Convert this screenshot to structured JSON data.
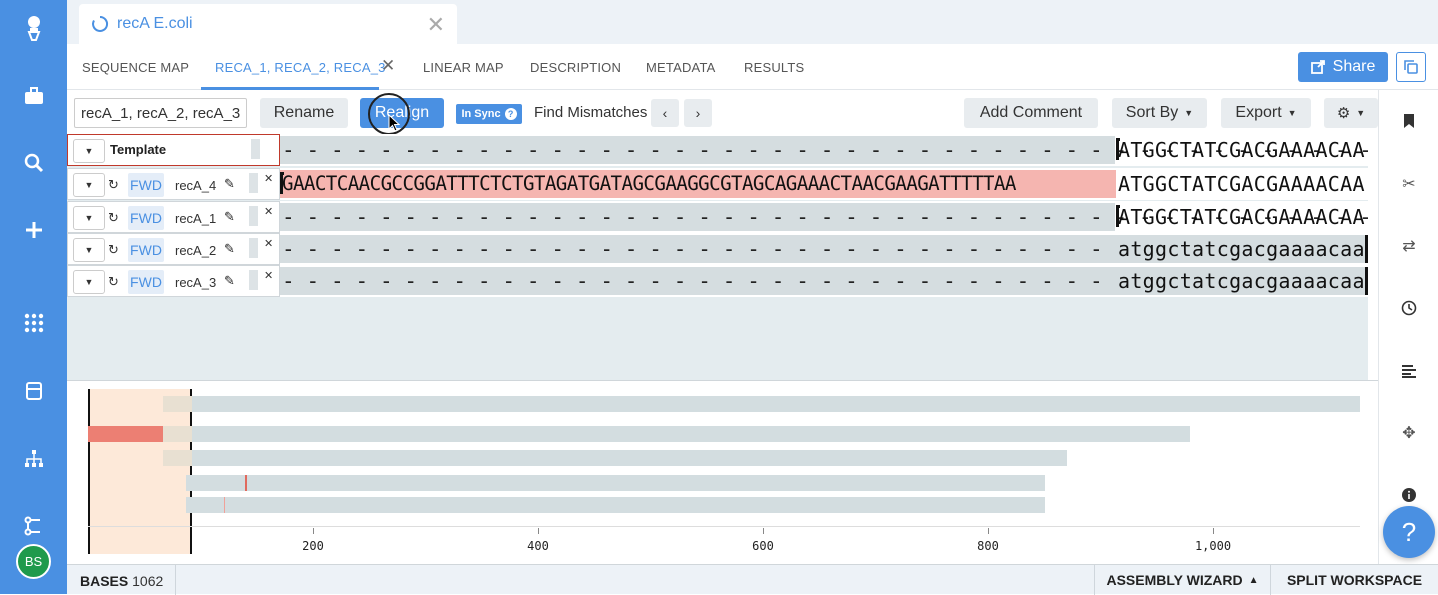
{
  "colors": {
    "accent": "#4a90e2",
    "mismatch": "#f5b5b0",
    "avatar": "#1f9a4c"
  },
  "leftnav": {
    "icons": [
      "logo-icon",
      "briefcase-icon",
      "search-icon",
      "plus-icon",
      "apps-grid-icon",
      "database-icon",
      "hierarchy-icon",
      "workflow-icon"
    ],
    "avatar": "BS"
  },
  "file_tab": {
    "title": "recA E.coli"
  },
  "tabs": [
    {
      "label": "SEQUENCE MAP"
    },
    {
      "label": "RECA_1, RECA_2, RECA_3"
    },
    {
      "label": "LINEAR MAP"
    },
    {
      "label": "DESCRIPTION"
    },
    {
      "label": "METADATA"
    },
    {
      "label": "RESULTS"
    }
  ],
  "share_label": "Share",
  "toolbar": {
    "name_value": "recA_1, recA_2, recA_3",
    "rename": "Rename",
    "realign": "Realign",
    "insync": "In Sync",
    "find_mismatches": "Find Mismatches",
    "add_comment": "Add Comment",
    "sort_by": "Sort By",
    "export": "Export"
  },
  "alignment": {
    "template_label": "Template",
    "template_bases": "ATGGCTATCGACGAAAACAA",
    "rows": [
      {
        "dir": "FWD",
        "name": "recA_4",
        "mismatch_bases": "GAACTCAACGCCGGATTTCTCTGTAGATGATAGCGAAGGCGTAGCAGAAACTAACGAAGATTTTTAA",
        "bases": "ATGGCTATCGACGAAAACAA"
      },
      {
        "dir": "FWD",
        "name": "recA_1",
        "bases": "ATGGCTATCGACGAAAACAA"
      },
      {
        "dir": "FWD",
        "name": "recA_2",
        "bases": "atggctatcgacgaaaacaa"
      },
      {
        "dir": "FWD",
        "name": "recA_3",
        "bases": "atggctatcgacgaaaacaa"
      }
    ]
  },
  "overview": {
    "ticks": [
      "200",
      "400",
      "600",
      "800",
      "1,000"
    ]
  },
  "status": {
    "bases_label": "BASES",
    "bases_value": "1062",
    "assembly_wizard": "ASSEMBLY WIZARD",
    "split_workspace": "SPLIT WORKSPACE"
  }
}
